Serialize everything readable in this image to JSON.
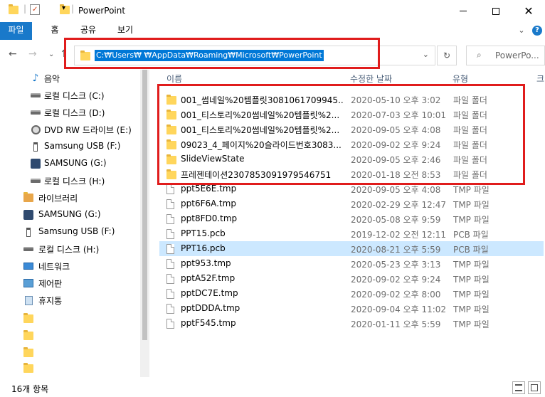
{
  "window": {
    "title": "PowerPoint",
    "qat_dropdown": "▾"
  },
  "ribbon": {
    "tabs": [
      {
        "label": "파일"
      },
      {
        "label": "홈"
      },
      {
        "label": "공유"
      },
      {
        "label": "보기"
      }
    ]
  },
  "address": {
    "path": "C:₩Users₩        ₩AppData₩Roaming₩Microsoft₩PowerPoint",
    "search_placeholder": "PowerPo..."
  },
  "columns": {
    "name": "이름",
    "date": "수정한 날짜",
    "type": "유형",
    "size": "크"
  },
  "sidebar": {
    "items": [
      {
        "label": "음악",
        "icon": "music-icon"
      },
      {
        "label": "로컬 디스크 (C:)",
        "icon": "drive-icon"
      },
      {
        "label": "로컬 디스크 (D:)",
        "icon": "drive-icon"
      },
      {
        "label": "DVD RW 드라이브 (E:)",
        "icon": "dvd-icon"
      },
      {
        "label": "Samsung USB (F:)",
        "icon": "usb-icon"
      },
      {
        "label": "SAMSUNG (G:)",
        "icon": "samsung-icon"
      },
      {
        "label": "로컬 디스크 (H:)",
        "icon": "drive-icon"
      },
      {
        "label": "라이브러리",
        "icon": "library-icon"
      },
      {
        "label": "SAMSUNG (G:)",
        "icon": "samsung-icon"
      },
      {
        "label": "Samsung USB (F:)",
        "icon": "usb-icon"
      },
      {
        "label": "로컬 디스크 (H:)",
        "icon": "drive-icon"
      },
      {
        "label": "네트워크",
        "icon": "network-icon"
      },
      {
        "label": "제어판",
        "icon": "control-panel-icon"
      },
      {
        "label": "휴지통",
        "icon": "recycle-bin-icon"
      }
    ]
  },
  "files": [
    {
      "name": "001_썸네일%20템플릿3081061709945...",
      "date": "2020-05-10 오후 3:02",
      "type": "파일 폴더",
      "kind": "folder"
    },
    {
      "name": "001_티스토리%20썸네일%20템플릿%2...",
      "date": "2020-07-03 오후 10:01",
      "type": "파일 폴더",
      "kind": "folder"
    },
    {
      "name": "001_티스토리%20썸네일%20템플릿%2...",
      "date": "2020-09-05 오후 4:08",
      "type": "파일 폴더",
      "kind": "folder"
    },
    {
      "name": "09023_4_페이지%20슬라이드번호3083...",
      "date": "2020-09-02 오후 9:24",
      "type": "파일 폴더",
      "kind": "folder"
    },
    {
      "name": "SlideViewState",
      "date": "2020-09-05 오후 2:46",
      "type": "파일 폴더",
      "kind": "folder"
    },
    {
      "name": "프레젠테이션2307853091979546751",
      "date": "2020-01-18 오전 8:53",
      "type": "파일 폴더",
      "kind": "folder"
    },
    {
      "name": "ppt5E6E.tmp",
      "date": "2020-09-05 오후 4:08",
      "type": "TMP 파일",
      "kind": "file"
    },
    {
      "name": "ppt6F6A.tmp",
      "date": "2020-02-29 오후 12:47",
      "type": "TMP 파일",
      "kind": "file"
    },
    {
      "name": "ppt8FD0.tmp",
      "date": "2020-05-08 오후 9:59",
      "type": "TMP 파일",
      "kind": "file"
    },
    {
      "name": "PPT15.pcb",
      "date": "2019-12-02 오전 12:11",
      "type": "PCB 파일",
      "kind": "file"
    },
    {
      "name": "PPT16.pcb",
      "date": "2020-08-21 오후 5:59",
      "type": "PCB 파일",
      "kind": "file"
    },
    {
      "name": "ppt953.tmp",
      "date": "2020-05-23 오후 3:13",
      "type": "TMP 파일",
      "kind": "file"
    },
    {
      "name": "pptA52F.tmp",
      "date": "2020-09-02 오후 9:24",
      "type": "TMP 파일",
      "kind": "file"
    },
    {
      "name": "pptDC7E.tmp",
      "date": "2020-09-02 오후 8:00",
      "type": "TMP 파일",
      "kind": "file"
    },
    {
      "name": "pptDDDA.tmp",
      "date": "2020-09-04 오후 11:02",
      "type": "TMP 파일",
      "kind": "file"
    },
    {
      "name": "pptF545.tmp",
      "date": "2020-01-11 오후 5:59",
      "type": "TMP 파일",
      "kind": "file"
    }
  ],
  "selected_row": 10,
  "status": {
    "item_count": "16개 항목"
  },
  "colors": {
    "accent": "#1979ca",
    "highlight": "#e01c1c",
    "selection": "#cce8ff",
    "folder": "#ffd65c"
  }
}
